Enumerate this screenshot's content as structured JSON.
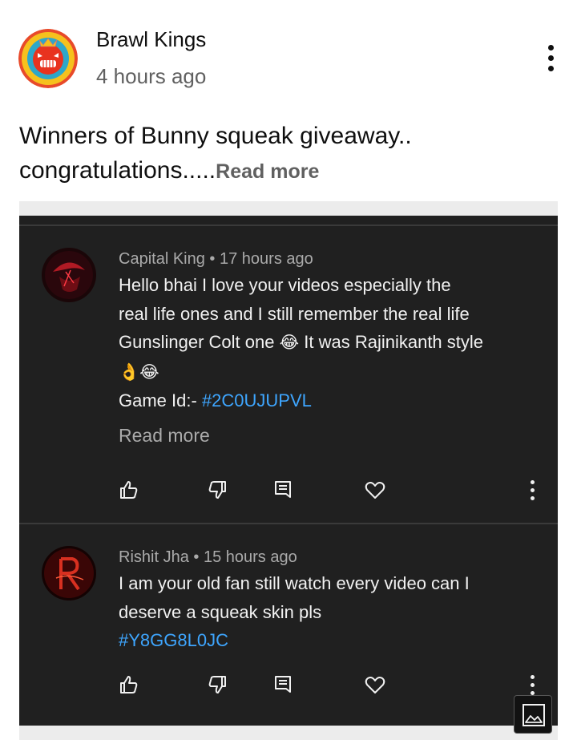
{
  "post": {
    "channel_name": "Brawl Kings",
    "time": "4 hours ago",
    "text": "Winners of Bunny squeak giveaway.. congratulations.....",
    "read_more": "Read more"
  },
  "comments": [
    {
      "author": "Capital King",
      "time": "17 hours ago",
      "text_lines": [
        "Hello bhai I love your videos especially the",
        "real life ones and I still remember the real life",
        "Gunslinger Colt one",
        "It was Rajinikanth style"
      ],
      "emoji": [
        "😂",
        "👌",
        "😂"
      ],
      "game_id_label": "Game Id:-",
      "game_id": "#2C0UJUPVL",
      "read_more": "Read more"
    },
    {
      "author": "Rishit Jha",
      "time": "15 hours ago",
      "text_lines": [
        "I am your old fan still watch every video can I",
        "deserve a squeak skin pls"
      ],
      "game_id": "#Y8GG8L0JC"
    }
  ],
  "separator": "•",
  "icons": {
    "like": "thumbs-up-icon",
    "dislike": "thumbs-down-icon",
    "reply": "comment-icon",
    "heart": "heart-icon",
    "more": "more-vertical-icon",
    "gallery": "image-icon"
  },
  "colors": {
    "hashtag": "#3ea6ff",
    "dark_bg": "#202020",
    "meta": "#aaaaaa"
  }
}
